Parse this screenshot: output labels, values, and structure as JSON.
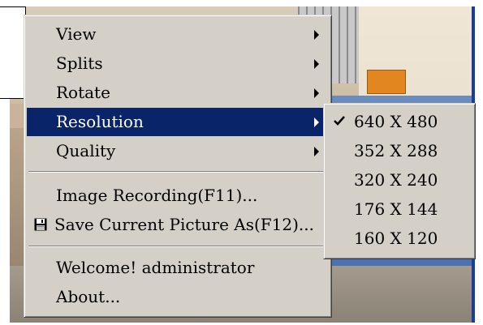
{
  "menu": {
    "items": [
      {
        "label": "View",
        "has_submenu": true
      },
      {
        "label": "Splits",
        "has_submenu": true
      },
      {
        "label": "Rotate",
        "has_submenu": true
      },
      {
        "label": "Resolution",
        "has_submenu": true,
        "highlighted": true
      },
      {
        "label": "Quality",
        "has_submenu": true
      },
      {
        "label": "Image Recording(F11)..."
      },
      {
        "label": "Save Current Picture As(F12)...",
        "icon": "floppy-disk-icon"
      },
      {
        "label": "Welcome! administrator"
      },
      {
        "label": "About..."
      }
    ]
  },
  "resolution_submenu": {
    "items": [
      {
        "label": "640 X 480",
        "checked": true
      },
      {
        "label": "352 X 288"
      },
      {
        "label": "320 X 240"
      },
      {
        "label": "176 X 144"
      },
      {
        "label": "160 X 120"
      }
    ]
  },
  "colors": {
    "menu_bg": "#d4d0c8",
    "highlight": "#0a246a"
  }
}
